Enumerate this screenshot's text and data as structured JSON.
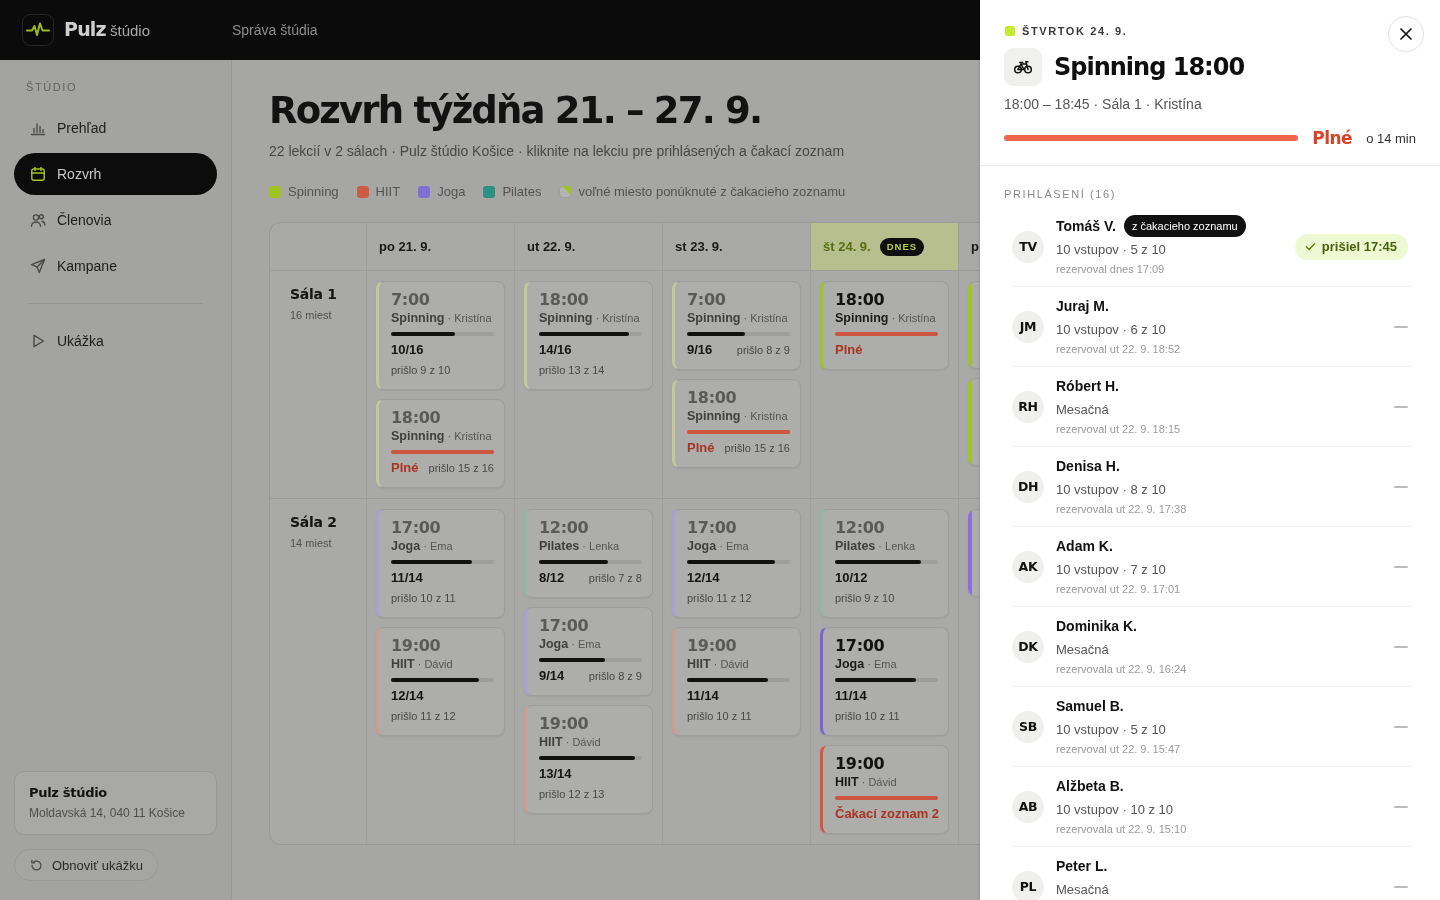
{
  "topbar": {
    "brand": "**Pulz** štúdio",
    "section": "Správa štúdia"
  },
  "sidebar": {
    "heading": "ŠTÚDIO",
    "items": [
      {
        "label": "Prehľad",
        "selected": false
      },
      {
        "label": "Rozvrh",
        "selected": true
      },
      {
        "label": "Členovia",
        "selected": false
      },
      {
        "label": "Kampane",
        "selected": false
      }
    ],
    "demo_items": [
      {
        "label": "Ukážka",
        "selected": false
      }
    ],
    "studio": {
      "name": "Pulz štúdio",
      "address": "Moldavská 14, 040 11 Košice"
    },
    "reset_button": "Obnoviť ukážku"
  },
  "schedule": {
    "title": "Rozvrh týždňa 21. – 27. 9.",
    "subtitle": "22 lekcií v 2 sálach · Pulz štúdio Košice · kliknite na lekciu pre prihlásených a čakací zoznam",
    "legend": [
      {
        "kind": "category",
        "label": "Spinning",
        "color": "#9ec21f"
      },
      {
        "kind": "category",
        "label": "HIIT",
        "color": "#cf5a44"
      },
      {
        "kind": "category",
        "label": "Joga",
        "color": "#7f6fd0"
      },
      {
        "kind": "category",
        "label": "Pilates",
        "color": "#2d9080"
      },
      {
        "kind": "offer",
        "label": "voľné miesto ponúknuté z čakacieho zoznamu",
        "color": "#9ec21f"
      }
    ],
    "days": [
      {
        "label": "po 21. 9.",
        "today": false
      },
      {
        "label": "ut 22. 9.",
        "today": false
      },
      {
        "label": "st 23. 9.",
        "today": false
      },
      {
        "label": "št 24. 9.",
        "today": true,
        "badge": "DNES"
      },
      {
        "label": "p",
        "today": false
      }
    ],
    "rooms": [
      {
        "name": "Sála 1",
        "capacity": "16 miest",
        "days": [
          [
            {
              "time": "7:00",
              "subtitle": "**Spinning** · Kristína",
              "color": "#c3ca9a",
              "past": true,
              "level": 0.625,
              "status": {
                "kind": "count",
                "label": "10/16"
              },
              "attended": "prišlo 9 z 10"
            },
            {
              "time": "18:00",
              "subtitle": "**Spinning** · Kristína",
              "color": "#c3ca9a",
              "past": true,
              "level": 1,
              "status": {
                "kind": "full",
                "label": "Plné"
              },
              "attended": "prišlo 15 z 16"
            }
          ],
          [
            {
              "time": "18:00",
              "subtitle": "**Spinning** · Kristína",
              "color": "#c3ca9a",
              "past": true,
              "level": 0.875,
              "status": {
                "kind": "count",
                "label": "14/16"
              },
              "attended": "prišlo 13 z 14"
            }
          ],
          [
            {
              "time": "7:00",
              "subtitle": "**Spinning** · Kristína",
              "color": "#c3ca9a",
              "past": true,
              "level": 0.5625,
              "status": {
                "kind": "count",
                "label": "9/16"
              },
              "attended": "prišlo 8 z 9"
            },
            {
              "time": "18:00",
              "subtitle": "**Spinning** · Kristína",
              "color": "#c3ca9a",
              "past": true,
              "level": 1,
              "status": {
                "kind": "full",
                "label": "Plné"
              },
              "attended": "prišlo 15 z 16"
            }
          ],
          [
            {
              "time": "18:00",
              "subtitle": "**Spinning** · Kristína",
              "color": "#a2c41e",
              "past": false,
              "level": 1,
              "status": {
                "kind": "full",
                "label": "Plné"
              }
            }
          ],
          [
            {
              "color": "#a2c41e"
            },
            {
              "color": "#a2c41e"
            }
          ]
        ]
      },
      {
        "name": "Sála 2",
        "capacity": "14 miest",
        "days": [
          [
            {
              "time": "17:00",
              "subtitle": "**Joga** · Ema",
              "color": "#a9a1cf",
              "past": true,
              "level": 0.786,
              "status": {
                "kind": "count",
                "label": "11/14"
              },
              "attended": "prišlo 10 z 11"
            },
            {
              "time": "19:00",
              "subtitle": "**HIIT** · Dávid",
              "color": "#cf9d92",
              "past": true,
              "level": 0.857,
              "status": {
                "kind": "count",
                "label": "12/14"
              },
              "attended": "prišlo 11 z 12"
            }
          ],
          [
            {
              "time": "12:00",
              "subtitle": "**Pilates** · Lenka",
              "color": "#90b8ac",
              "past": true,
              "level": 0.667,
              "status": {
                "kind": "count",
                "label": "8/12"
              },
              "attended": "prišlo 7 z 8"
            },
            {
              "time": "17:00",
              "subtitle": "**Joga** · Ema",
              "color": "#a9a1cf",
              "past": true,
              "level": 0.643,
              "status": {
                "kind": "count",
                "label": "9/14"
              },
              "attended": "prišlo 8 z 9"
            },
            {
              "time": "19:00",
              "subtitle": "**HIIT** · Dávid",
              "color": "#cf9d92",
              "past": true,
              "level": 0.929,
              "status": {
                "kind": "count",
                "label": "13/14"
              },
              "attended": "prišlo 12 z 13"
            }
          ],
          [
            {
              "time": "17:00",
              "subtitle": "**Joga** · Ema",
              "color": "#a9a1cf",
              "past": true,
              "level": 0.857,
              "status": {
                "kind": "count",
                "label": "12/14"
              },
              "attended": "prišlo 11 z 12"
            },
            {
              "time": "19:00",
              "subtitle": "**HIIT** · Dávid",
              "color": "#cf9d92",
              "past": true,
              "level": 0.786,
              "status": {
                "kind": "count",
                "label": "11/14"
              },
              "attended": "prišlo 10 z 11"
            }
          ],
          [
            {
              "time": "12:00",
              "subtitle": "**Pilates** · Lenka",
              "color": "#90b8ac",
              "past": true,
              "level": 0.833,
              "status": {
                "kind": "count",
                "label": "10/12"
              },
              "attended": "prišlo 9 z 10"
            },
            {
              "time": "17:00",
              "subtitle": "**Joga** · Ema",
              "color": "#7b63d6",
              "past": false,
              "level": 0.786,
              "status": {
                "kind": "count",
                "label": "11/14"
              },
              "attended": "prišlo 10 z 11"
            },
            {
              "time": "19:00",
              "subtitle": "**HIIT** · Dávid",
              "color": "#d9553a",
              "past": false,
              "level": 1,
              "status": {
                "kind": "waitlist",
                "label": "Čakací zoznam 2"
              }
            }
          ],
          [
            {
              "color": "#8a6fe0"
            }
          ]
        ]
      }
    ]
  },
  "detail": {
    "day": "ŠTVRTOK 24. 9.",
    "color": "#c4ec2c",
    "title": "Spinning 18:00",
    "meta": "18:00 – 18:45 · Sála 1 · Kristína",
    "level": 1,
    "status": {
      "kind": "full",
      "label": "Plné"
    },
    "countdown": "o 14 min",
    "attendees_heading": "PRIHLÁSENÍ (16)",
    "attendees": [
      {
        "initials": "TV",
        "name": "Tomáš V.",
        "badge": "z čakacieho zoznamu",
        "membership": "10 vstupov · 5 z 10",
        "booked": "rezervoval dnes 17:09",
        "checked_in": true,
        "checkin_label": "prišiel 17:45"
      },
      {
        "initials": "JM",
        "name": "Juraj M.",
        "membership": "10 vstupov · 6 z 10",
        "booked": "rezervoval ut 22. 9. 18:52",
        "checked_in": false
      },
      {
        "initials": "RH",
        "name": "Róbert H.",
        "membership": "Mesačná",
        "booked": "rezervoval ut 22. 9. 18:15",
        "checked_in": false
      },
      {
        "initials": "DH",
        "name": "Denisa H.",
        "membership": "10 vstupov · 8 z 10",
        "booked": "rezervovala ut 22. 9. 17:38",
        "checked_in": false
      },
      {
        "initials": "AK",
        "name": "Adam K.",
        "membership": "10 vstupov · 7 z 10",
        "booked": "rezervoval ut 22. 9. 17:01",
        "checked_in": false
      },
      {
        "initials": "DK",
        "name": "Dominika K.",
        "membership": "Mesačná",
        "booked": "rezervovala ut 22. 9. 16:24",
        "checked_in": false
      },
      {
        "initials": "SB",
        "name": "Samuel B.",
        "membership": "10 vstupov · 5 z 10",
        "booked": "rezervoval ut 22. 9. 15:47",
        "checked_in": false
      },
      {
        "initials": "AB",
        "name": "Alžbeta B.",
        "membership": "10 vstupov · 10 z 10",
        "booked": "rezervovala ut 22. 9. 15:10",
        "checked_in": false
      },
      {
        "initials": "PL",
        "name": "Peter L.",
        "membership": "Mesačná",
        "checked_in": false
      }
    ]
  }
}
